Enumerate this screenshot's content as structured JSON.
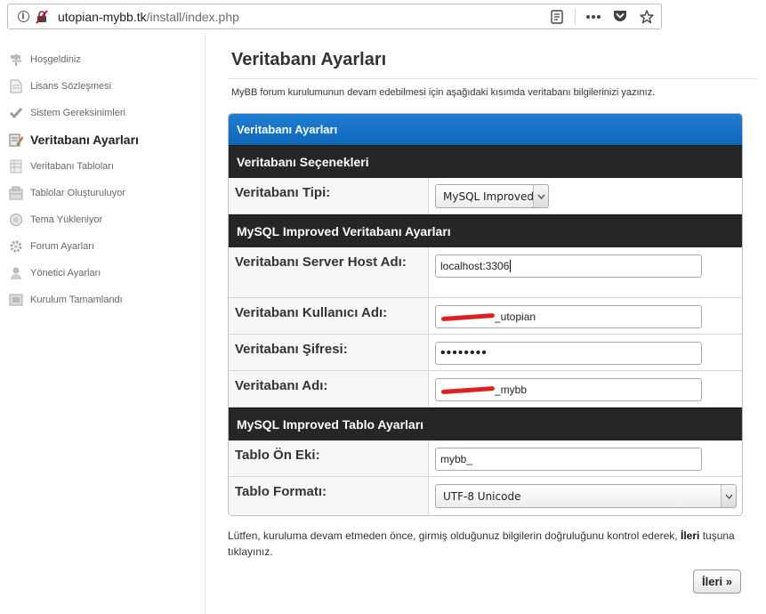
{
  "browser": {
    "url_host": "utopian-mybb.tk",
    "url_path": "/install/index.php"
  },
  "sidebar": {
    "items": [
      {
        "label": "Hoşgeldiniz",
        "icon": "welcome-sign-icon"
      },
      {
        "label": "Lisans Sözleşmesi",
        "icon": "document-icon"
      },
      {
        "label": "Sistem Gereksinimleri",
        "icon": "checkmark-icon"
      },
      {
        "label": "Veritabanı Ayarları",
        "icon": "database-edit-icon",
        "active": true
      },
      {
        "label": "Veritabanı Tabloları",
        "icon": "table-icon"
      },
      {
        "label": "Tablolar Oluşturuluyor",
        "icon": "table-build-icon"
      },
      {
        "label": "Tema Yükleniyor",
        "icon": "theme-icon"
      },
      {
        "label": "Forum Ayarları",
        "icon": "gear-icon"
      },
      {
        "label": "Yönetici Ayarları",
        "icon": "user-icon"
      },
      {
        "label": "Kurulum Tamamlandı",
        "icon": "finish-icon"
      }
    ]
  },
  "main": {
    "title": "Veritabanı Ayarları",
    "intro": "MyBB forum kurulumunun devam edebilmesi için aşağıdaki kısımda veritabanı bilgilerinizi yazınız.",
    "panel_title": "Veritabanı Ayarları",
    "sections": {
      "db_options": "Veritabanı Seçenekleri",
      "mysql_db": "MySQL Improved Veritabanı Ayarları",
      "mysql_table": "MySQL Improved Tablo Ayarları"
    },
    "fields": {
      "db_type": {
        "label": "Veritabanı Tipi:",
        "value": "MySQL Improved"
      },
      "host": {
        "label": "Veritabanı Server Host Adı:",
        "value": "localhost:3306"
      },
      "user": {
        "label": "Veritabanı Kullanıcı Adı:",
        "value": "_utopian"
      },
      "password": {
        "label": "Veritabanı Şifresi:",
        "value": "••••••••"
      },
      "db_name": {
        "label": "Veritabanı Adı:",
        "value": "_mybb"
      },
      "prefix": {
        "label": "Tablo Ön Eki:",
        "value": "mybb_"
      },
      "format": {
        "label": "Tablo Formatı:",
        "value": "UTF-8 Unicode"
      }
    },
    "footer_before": "Lütfen, kuruluma devam etmeden önce, girmiş olduğunuz bilgilerin doğruluğunu kontrol ederek,",
    "footer_bold": "İleri",
    "footer_after": "tuşuna tıklayınız.",
    "next_button": "İleri »"
  }
}
